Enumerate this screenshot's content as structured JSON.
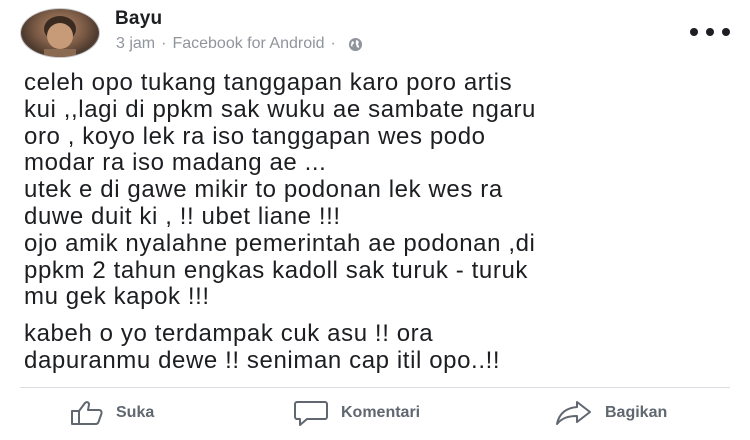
{
  "post": {
    "author": "Bayu",
    "time": "3 jam",
    "separator": "·",
    "source": "Facebook for Android",
    "privacy_icon": "globe-icon",
    "body_lines": [
      "celeh opo tukang tanggapan karo poro artis",
      "kui ,,lagi di ppkm sak wuku ae sambate ngaru",
      "oro , koyo lek ra iso tanggapan wes podo",
      "modar ra iso madang ae ...",
      "utek e di gawe mikir to podonan lek wes ra",
      "duwe duit ki , !! ubet liane !!!",
      "ojo amik nyalahne pemerintah ae podonan ,di",
      "ppkm 2 tahun engkas kadoll sak turuk - turuk",
      "mu gek kapok !!!",
      "kabeh o yo terdampak cuk asu !! ora",
      "dapuranmu dewe !! seniman cap itil opo..!!"
    ]
  },
  "actions": {
    "like": "Suka",
    "comment": "Komentari",
    "share": "Bagikan"
  },
  "icons": {
    "more": "more-options-icon",
    "like": "thumbs-up-icon",
    "comment": "comment-bubble-icon",
    "share": "share-arrow-icon"
  },
  "colors": {
    "text": "#1c1e21",
    "meta": "#90949c",
    "action": "#606770",
    "divider": "#dadde1"
  }
}
